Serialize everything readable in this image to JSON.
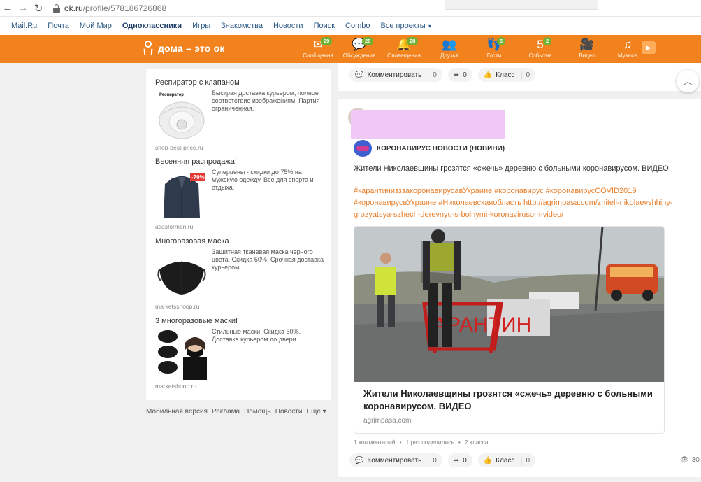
{
  "browser": {
    "back_icon": "←",
    "forward_icon": "→",
    "reload_icon": "↻",
    "url_host": "ok.ru",
    "url_path": "/profile/578186726868"
  },
  "portal": {
    "links": [
      "Mail.Ru",
      "Почта",
      "Мой Мир",
      "Одноклассники",
      "Игры",
      "Знакомства",
      "Новости",
      "Поиск",
      "Combo",
      "Все проекты"
    ],
    "active_index": 3
  },
  "toolbar": {
    "logo_text": "дома – это ок",
    "items": [
      {
        "label": "Сообщения",
        "icon": "✉",
        "badge": "29"
      },
      {
        "label": "Обсуждения",
        "icon": "💬",
        "badge": "28"
      },
      {
        "label": "Оповещения",
        "icon": "🔔",
        "badge": "28"
      },
      {
        "label": "Друзья",
        "icon": "👥",
        "badge": ""
      },
      {
        "label": "Гости",
        "icon": "👣",
        "badge": "5"
      },
      {
        "label": "События",
        "icon": "5",
        "badge": "2"
      },
      {
        "label": "Видео",
        "icon": "🎥",
        "badge": ""
      },
      {
        "label": "Музыка",
        "icon": "♫",
        "badge": ""
      }
    ],
    "accent_color": "#f1821e",
    "badge_color": "#6fb133"
  },
  "ads": [
    {
      "title": "Респиратор с клапаном",
      "desc": "Быстрая доставка курьером, полное соответствие изображениям. Партия ограниченная.",
      "domain": "shop-best-price.ru",
      "img_label": "Респиратор"
    },
    {
      "title": "Весенняя распродажа!",
      "desc": "Суперцены - скидки до 75% на мужскую одежду. Все для спорта и отдыха.",
      "domain": "atlasformen.ru",
      "img_label": "-70%"
    },
    {
      "title": "Многоразовая маска",
      "desc": "Защитная тканевая маска черного цвета. Скидка 50%. Срочная доставка курьером.",
      "domain": "marketsshoop.ru"
    },
    {
      "title": "3 многоразовые маски!",
      "desc": "Стильные маски. Скидка 50%. Доставка курьером до двери.",
      "domain": "marketshoop.ru"
    }
  ],
  "footer": [
    "Мобильная версия",
    "Реклама",
    "Помощь",
    "Новости",
    "Ещё ▾"
  ],
  "top_actions": {
    "comment_label": "Комментировать",
    "comment_count": "0",
    "share_count": "0",
    "like_label": "Класс",
    "like_count": "0"
  },
  "post": {
    "group_name": "КОРОНАВИРУС НОВОСТИ (НОВИНИ)",
    "text": "Жители Николаевщины грозятся «сжечь» деревню с больными коронавирусом. ВИДЕО",
    "tags": " #карантинизззакоронавирусавУкраине #коронавирус #коронавирусCOVID2019 #коронавирусвУкраине #Николаевскаяобласть http://agrimpasa.com/zhiteli-nikolaevshhiny-grozyatsya-szhech-derevnyu-s-bolnymi-koronavirusom-video/",
    "preview_title": "Жители Николаевщины грозятся «сжечь» деревню с больными коронавирусом. ВИДЕО",
    "preview_domain": "agrimpasa.com",
    "preview_sign": "АРАНТИН",
    "stats": [
      "1 комментарий",
      "1 раз поделились",
      "2 класса"
    ],
    "comment_label": "Комментировать",
    "comment_count": "0",
    "share_count": "0",
    "like_label": "Класс",
    "like_count": "0",
    "views": "30"
  }
}
